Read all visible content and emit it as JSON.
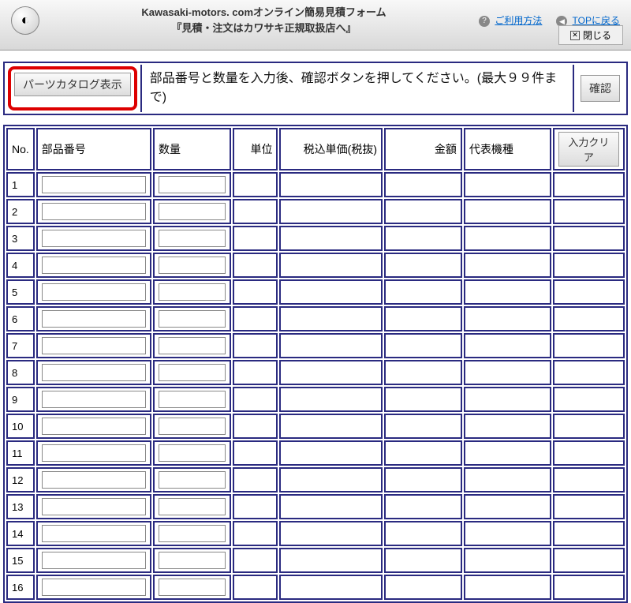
{
  "header": {
    "title_line1": "Kawasaki-motors. comオンライン簡易見積フォーム",
    "title_line2": "『見積・注文はカワサキ正規取扱店へ』",
    "usage_link": "ご利用方法",
    "top_link": "TOPに戻る",
    "close_label": "閉じる"
  },
  "instruction": {
    "catalog_button": "パーツカタログ表示",
    "text": "部品番号と数量を入力後、確認ボタンを押してください。(最大９９件まで)",
    "confirm_button": "確認"
  },
  "table": {
    "headers": {
      "no": "No.",
      "part_number": "部品番号",
      "quantity": "数量",
      "unit": "単位",
      "price_incl_tax": "税込単価(税抜)",
      "amount": "金額",
      "rep_model": "代表機種",
      "clear_button": "入力クリア"
    },
    "rows": [
      {
        "no": "1",
        "part": "",
        "qty": ""
      },
      {
        "no": "2",
        "part": "",
        "qty": ""
      },
      {
        "no": "3",
        "part": "",
        "qty": ""
      },
      {
        "no": "4",
        "part": "",
        "qty": ""
      },
      {
        "no": "5",
        "part": "",
        "qty": ""
      },
      {
        "no": "6",
        "part": "",
        "qty": ""
      },
      {
        "no": "7",
        "part": "",
        "qty": ""
      },
      {
        "no": "8",
        "part": "",
        "qty": ""
      },
      {
        "no": "9",
        "part": "",
        "qty": ""
      },
      {
        "no": "10",
        "part": "",
        "qty": ""
      },
      {
        "no": "11",
        "part": "",
        "qty": ""
      },
      {
        "no": "12",
        "part": "",
        "qty": ""
      },
      {
        "no": "13",
        "part": "",
        "qty": ""
      },
      {
        "no": "14",
        "part": "",
        "qty": ""
      },
      {
        "no": "15",
        "part": "",
        "qty": ""
      },
      {
        "no": "16",
        "part": "",
        "qty": ""
      }
    ]
  }
}
